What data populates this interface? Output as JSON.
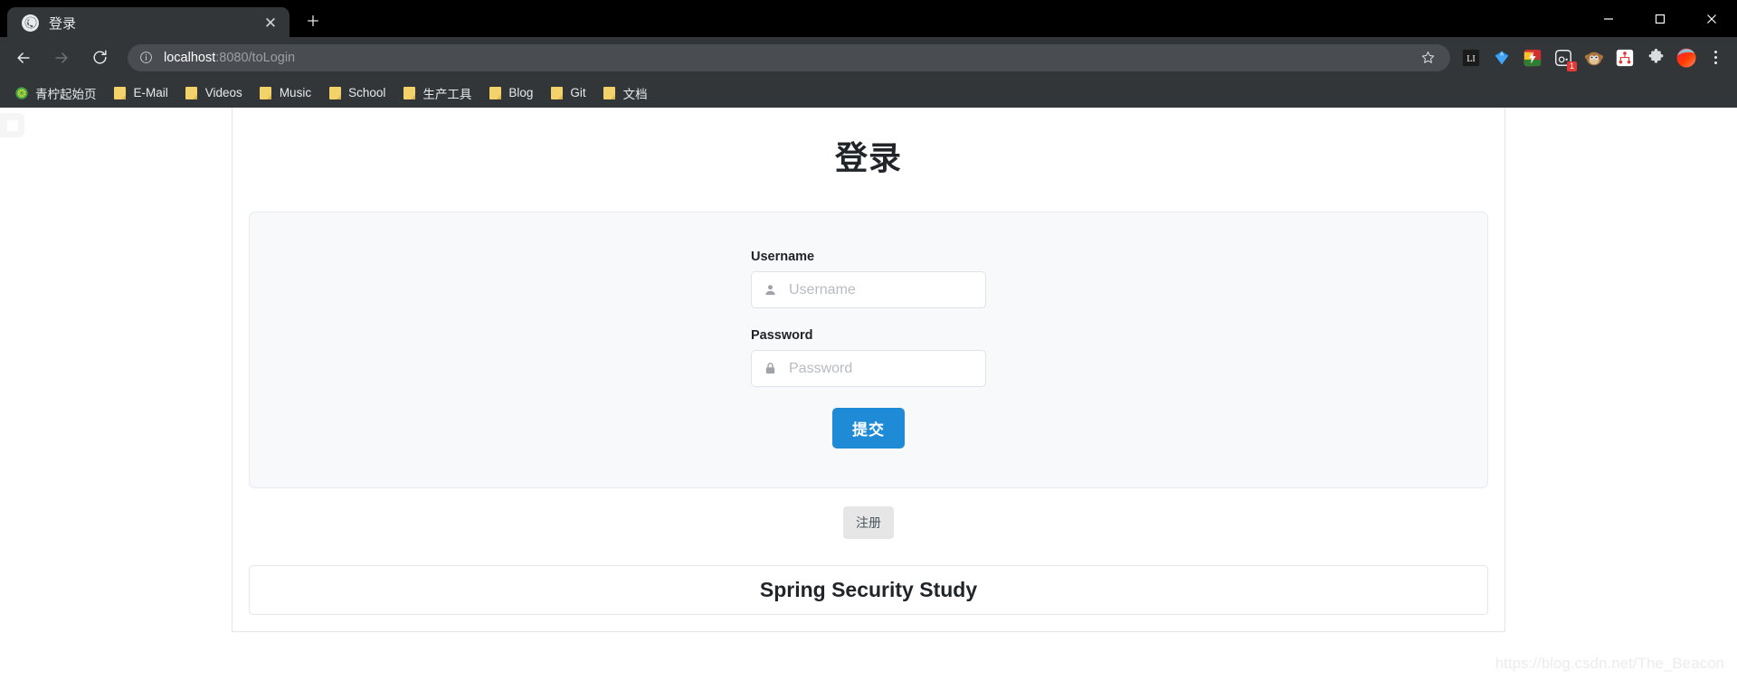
{
  "browser": {
    "tab": {
      "title": "登录",
      "favicon_icon": "globe-icon",
      "close_icon": "close-icon"
    },
    "new_tab_label": "+",
    "window_controls": {
      "minimize": "minimize-icon",
      "maximize": "maximize-icon",
      "close": "close-icon"
    },
    "nav": {
      "back": "back-arrow-icon",
      "forward": "forward-arrow-icon",
      "reload": "reload-icon"
    },
    "omnibox": {
      "info_icon": "info-circle-icon",
      "host": "localhost",
      "path": ":8080/toLogin",
      "url_full": "localhost:8080/toLogin",
      "star_icon": "bookmark-star-icon"
    },
    "extensions": [
      {
        "name": "li-extension-icon",
        "badge": null
      },
      {
        "name": "diamond-extension-icon",
        "badge": null
      },
      {
        "name": "colorful-flash-extension-icon",
        "badge": null
      },
      {
        "name": "screenshot-extension-icon",
        "badge": "1"
      },
      {
        "name": "monkey-avatar-extension-icon",
        "badge": null
      },
      {
        "name": "sitemap-extension-icon",
        "badge": null
      },
      {
        "name": "puzzle-extensions-icon",
        "badge": null
      },
      {
        "name": "profile-avatar-icon",
        "badge": null
      }
    ],
    "menu_icon": "three-dots-menu-icon",
    "bookmarks": [
      {
        "label": "青柠起始页",
        "icon": "lime-circle-icon"
      },
      {
        "label": "E-Mail",
        "icon": "folder-icon"
      },
      {
        "label": "Videos",
        "icon": "folder-icon"
      },
      {
        "label": "Music",
        "icon": "folder-icon"
      },
      {
        "label": "School",
        "icon": "folder-icon"
      },
      {
        "label": "生产工具",
        "icon": "folder-icon"
      },
      {
        "label": "Blog",
        "icon": "folder-icon"
      },
      {
        "label": "Git",
        "icon": "folder-icon"
      },
      {
        "label": "文档",
        "icon": "folder-icon"
      }
    ]
  },
  "page": {
    "title": "登录",
    "form": {
      "username": {
        "label": "Username",
        "placeholder": "Username",
        "value": "",
        "icon": "user-icon"
      },
      "password": {
        "label": "Password",
        "placeholder": "Password",
        "value": "",
        "icon": "lock-icon"
      },
      "submit_label": "提交",
      "submit_color": "#1f8ad6"
    },
    "register_label": "注册",
    "footer_text": "Spring Security Study",
    "watermark": "https://blog.csdn.net/The_Beacon"
  }
}
